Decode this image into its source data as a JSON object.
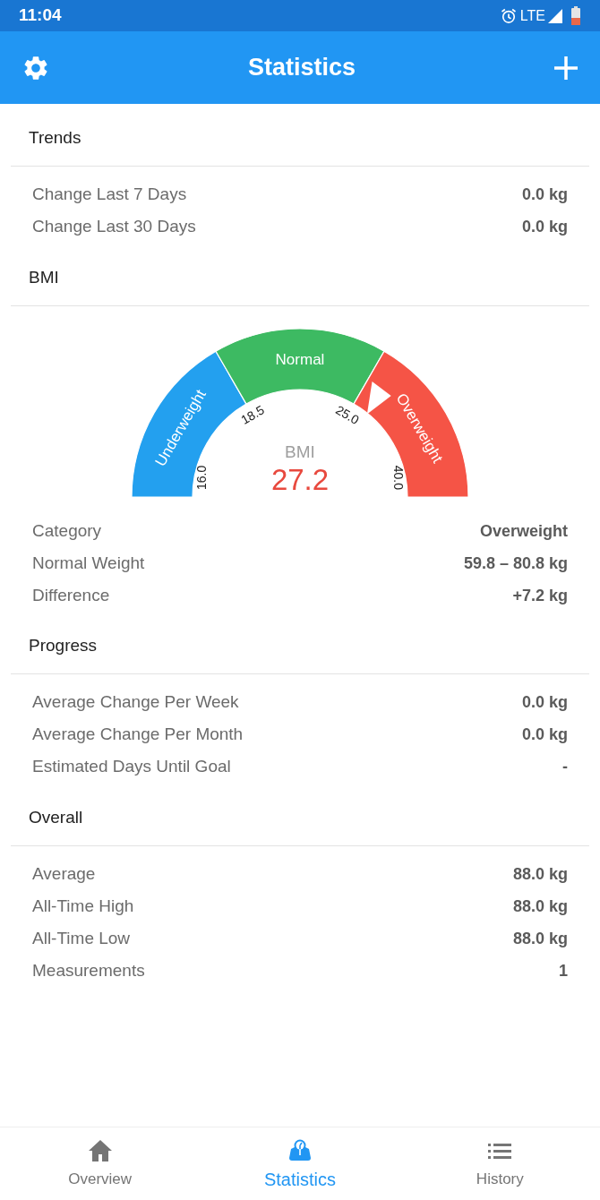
{
  "status_bar": {
    "time": "11:04",
    "network": "LTE"
  },
  "app_bar": {
    "title": "Statistics"
  },
  "sections": [
    {
      "title": "Trends",
      "rows": [
        {
          "label": "Change Last 7 Days",
          "value": "0.0 kg"
        },
        {
          "label": "Change Last 30 Days",
          "value": "0.0 kg"
        }
      ]
    },
    {
      "title": "BMI",
      "gauge": {
        "caption": "BMI",
        "value": "27.2",
        "segments": [
          {
            "label": "Underweight",
            "color": "#23a0ef"
          },
          {
            "label": "Normal",
            "color": "#3dba62"
          },
          {
            "label": "Overweight",
            "color": "#f55446"
          }
        ],
        "ticks": [
          "16.0",
          "18.5",
          "25.0",
          "40.0"
        ]
      },
      "rows": [
        {
          "label": "Category",
          "value": "Overweight"
        },
        {
          "label": "Normal Weight",
          "value": "59.8 – 80.8 kg"
        },
        {
          "label": "Difference",
          "value": "+7.2 kg"
        }
      ]
    },
    {
      "title": "Progress",
      "rows": [
        {
          "label": "Average Change Per Week",
          "value": "0.0 kg"
        },
        {
          "label": "Average Change Per Month",
          "value": "0.0 kg"
        },
        {
          "label": "Estimated Days Until Goal",
          "value": "-"
        }
      ]
    },
    {
      "title": "Overall",
      "rows": [
        {
          "label": "Average",
          "value": "88.0 kg"
        },
        {
          "label": "All-Time High",
          "value": "88.0 kg"
        },
        {
          "label": "All-Time Low",
          "value": "88.0 kg"
        },
        {
          "label": "Measurements",
          "value": "1"
        }
      ]
    }
  ],
  "bottom_nav": [
    {
      "label": "Overview",
      "selected": false
    },
    {
      "label": "Statistics",
      "selected": true
    },
    {
      "label": "History",
      "selected": false
    }
  ]
}
